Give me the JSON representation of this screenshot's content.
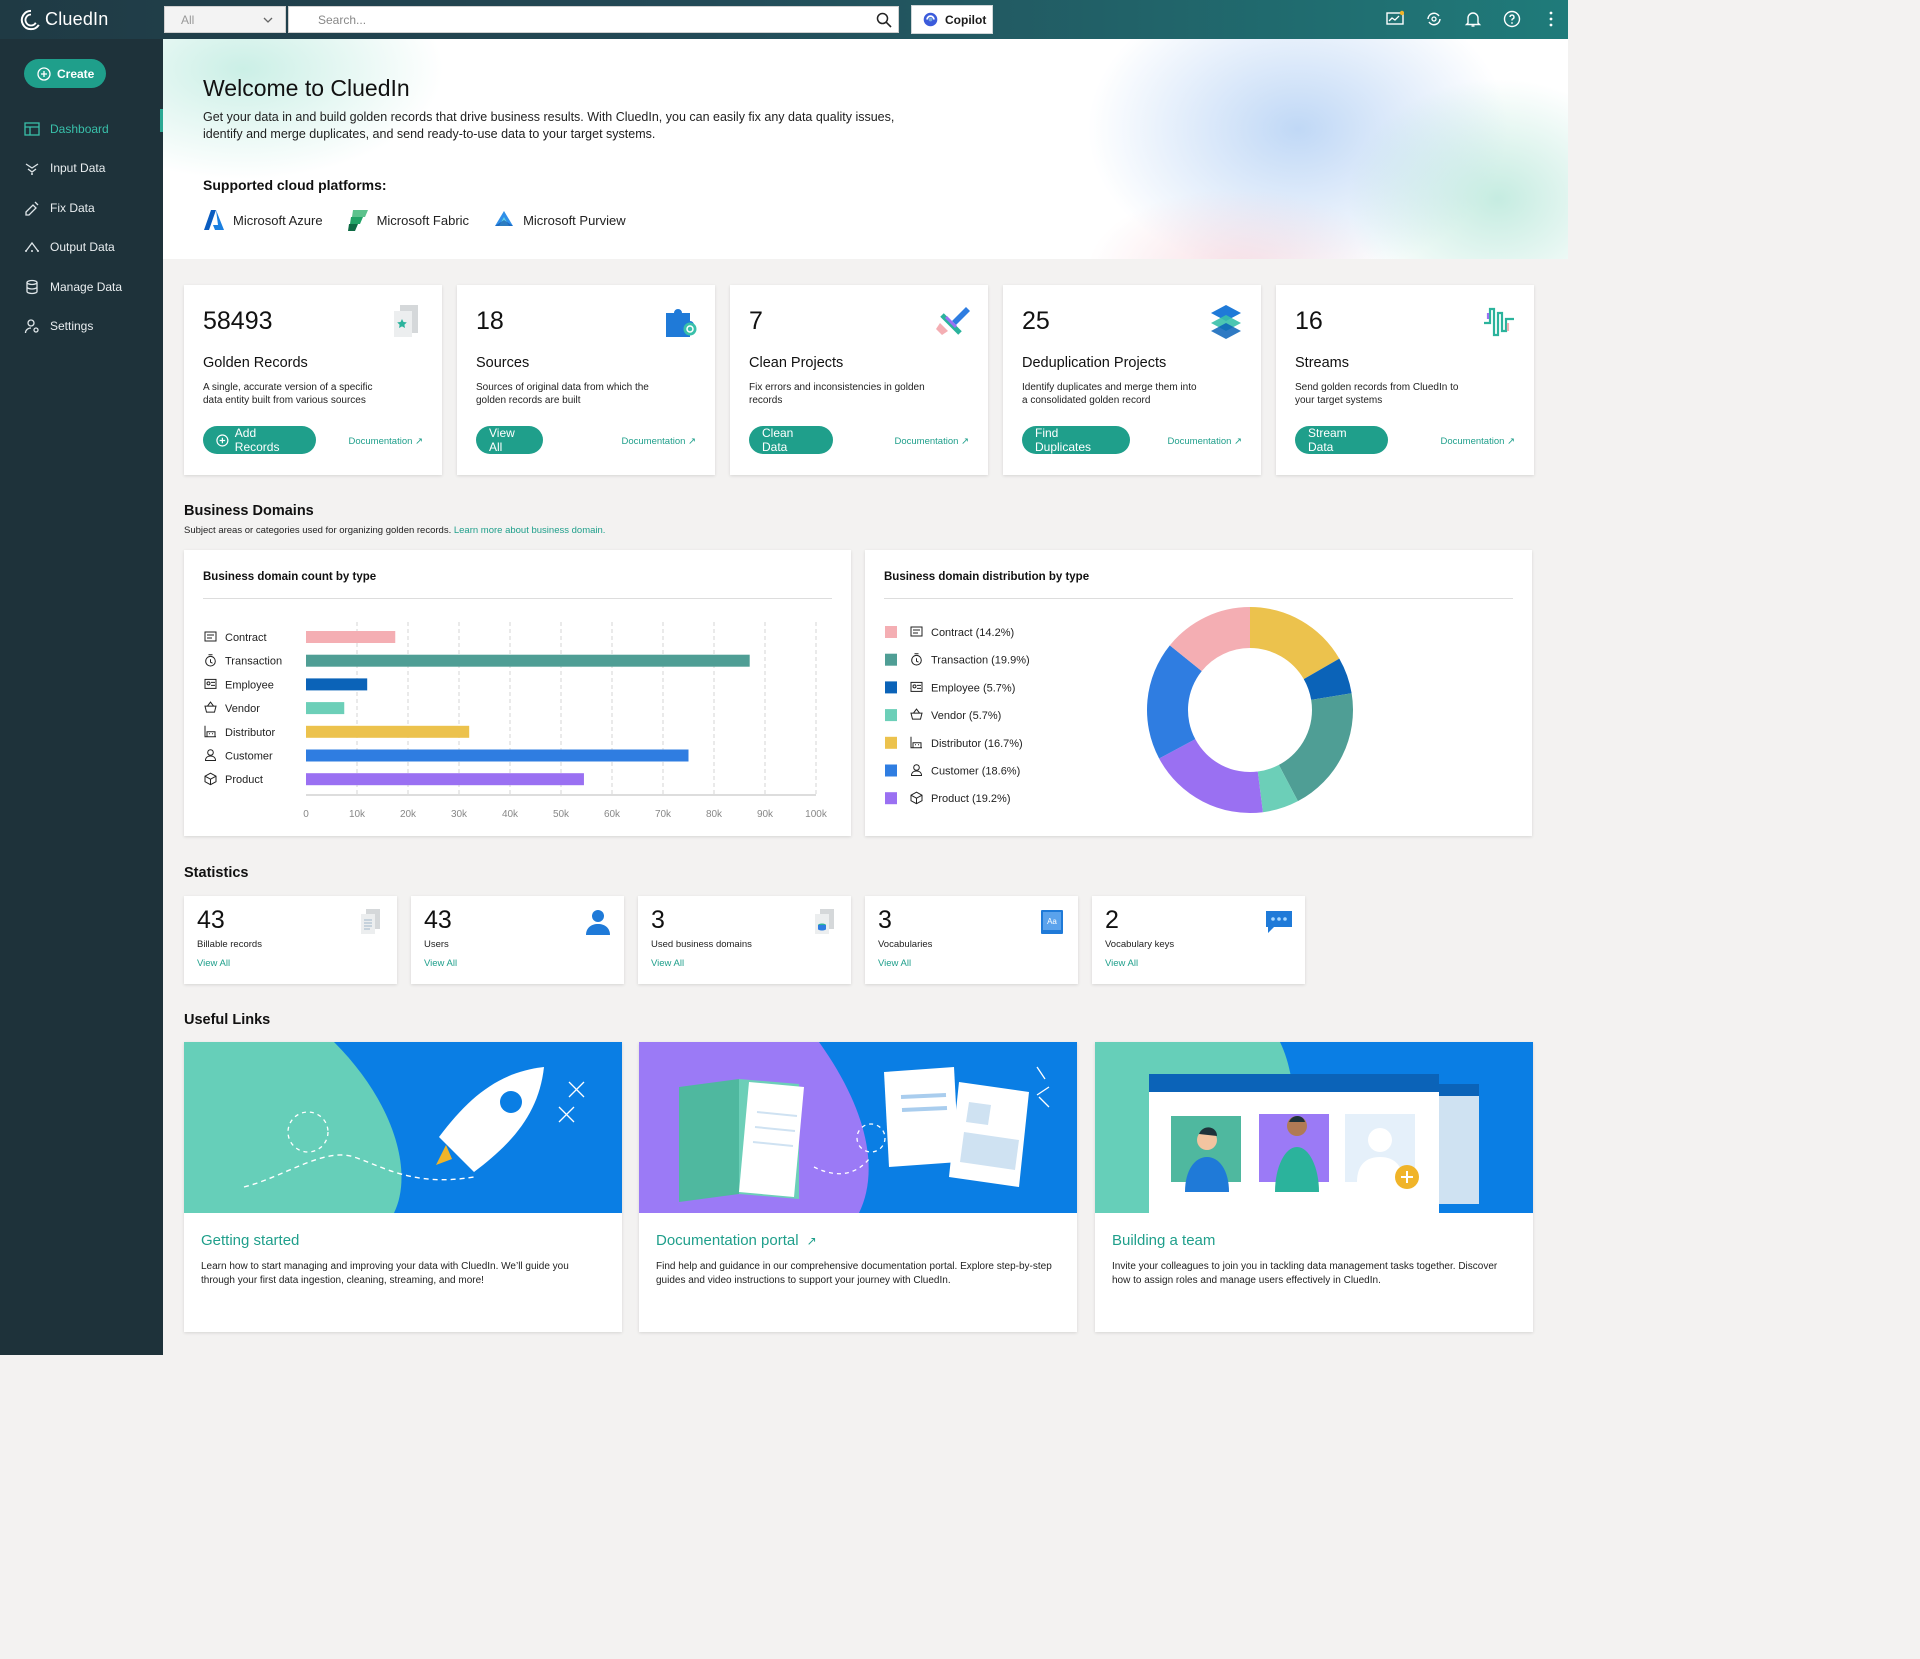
{
  "topbar": {
    "brand": "CluedIn",
    "scope_select": "All",
    "search_placeholder": "Search...",
    "copilot_label": "Copilot",
    "icons": [
      "monitor-icon",
      "sync-icon",
      "bell-icon",
      "help-icon",
      "more-icon"
    ]
  },
  "sidebar": {
    "create_label": "Create",
    "items": [
      {
        "label": "Dashboard",
        "icon": "dashboard-icon",
        "active": true
      },
      {
        "label": "Input Data",
        "icon": "input-data-icon"
      },
      {
        "label": "Fix Data",
        "icon": "fix-data-icon"
      },
      {
        "label": "Output Data",
        "icon": "output-data-icon"
      },
      {
        "label": "Manage Data",
        "icon": "manage-data-icon"
      },
      {
        "label": "Settings",
        "icon": "settings-icon"
      }
    ]
  },
  "hero": {
    "title": "Welcome to CluedIn",
    "intro": "Get your data in and build golden records that drive business results. With CluedIn, you can easily fix any data quality issues, identify and merge duplicates, and send ready-to-use data to your target systems.",
    "platforms_title": "Supported cloud platforms:",
    "platforms": [
      "Microsoft Azure",
      "Microsoft Fabric",
      "Microsoft Purview"
    ]
  },
  "cards": [
    {
      "value": "58493",
      "title": "Golden Records",
      "desc": "A single, accurate version of a specific data entity built from various sources",
      "button": "Add Records",
      "doc": "Documentation"
    },
    {
      "value": "18",
      "title": "Sources",
      "desc": "Sources of original data from which the golden records are built",
      "button": "View All",
      "doc": "Documentation"
    },
    {
      "value": "7",
      "title": "Clean Projects",
      "desc": "Fix errors and inconsistencies in golden records",
      "button": "Clean Data",
      "doc": "Documentation"
    },
    {
      "value": "25",
      "title": "Deduplication Projects",
      "desc": "Identify duplicates and merge them into a consolidated golden record",
      "button": "Find Duplicates",
      "doc": "Documentation"
    },
    {
      "value": "16",
      "title": "Streams",
      "desc": "Send golden records from CluedIn to your target systems",
      "button": "Stream Data",
      "doc": "Documentation"
    }
  ],
  "business_domains": {
    "title": "Business Domains",
    "subtitle": "Subject areas or categories used for organizing golden records.",
    "learn_more": "Learn more about business domain."
  },
  "chart_data": [
    {
      "type": "bar",
      "title": "Business domain count by type",
      "orientation": "horizontal",
      "categories": [
        "Contract",
        "Transaction",
        "Employee",
        "Vendor",
        "Distributor",
        "Customer",
        "Product"
      ],
      "values": [
        17500,
        87000,
        12000,
        7500,
        32000,
        75000,
        54500
      ],
      "colors": [
        "#f4aeb3",
        "#4f9e95",
        "#0b63b8",
        "#6ccfb8",
        "#ecc24d",
        "#2f7de1",
        "#9a70f2"
      ],
      "xlim": [
        0,
        100000
      ],
      "ticks": [
        "0",
        "10k",
        "20k",
        "30k",
        "40k",
        "50k",
        "60k",
        "70k",
        "80k",
        "90k",
        "100k"
      ],
      "grid": true
    },
    {
      "type": "pie",
      "title": "Business domain distribution by type",
      "donut": true,
      "labels": [
        "Contract (14.2%)",
        "Transaction (19.9%)",
        "Employee (5.7%)",
        "Vendor (5.7%)",
        "Distributor (16.7%)",
        "Customer (18.6%)",
        "Product (19.2%)"
      ],
      "values": [
        14.2,
        19.9,
        5.7,
        5.7,
        16.7,
        18.6,
        19.2
      ],
      "colors": [
        "#f4aeb3",
        "#4f9e95",
        "#0b63b8",
        "#6ccfb8",
        "#ecc24d",
        "#2f7de1",
        "#9a70f2"
      ],
      "legend": "left"
    }
  ],
  "statistics": {
    "title": "Statistics",
    "items": [
      {
        "value": "43",
        "label": "Billable records",
        "link": "View All"
      },
      {
        "value": "43",
        "label": "Users",
        "link": "View All"
      },
      {
        "value": "3",
        "label": "Used business domains",
        "link": "View All"
      },
      {
        "value": "3",
        "label": "Vocabularies",
        "link": "View All"
      },
      {
        "value": "2",
        "label": "Vocabulary keys",
        "link": "View All"
      }
    ]
  },
  "useful_links": {
    "title": "Useful Links",
    "items": [
      {
        "title": "Getting started",
        "desc": "Learn how to start managing and improving your data with CluedIn. We’ll guide you through your first data ingestion, cleaning, streaming, and more!"
      },
      {
        "title": "Documentation portal",
        "desc": "Find help and guidance in our comprehensive documentation portal. Explore step-by-step guides and video instructions to support your journey with CluedIn."
      },
      {
        "title": "Building a team",
        "desc": "Invite your colleagues to join you in tackling data management tasks together. Discover how to assign roles and manage users effectively in CluedIn."
      }
    ]
  }
}
